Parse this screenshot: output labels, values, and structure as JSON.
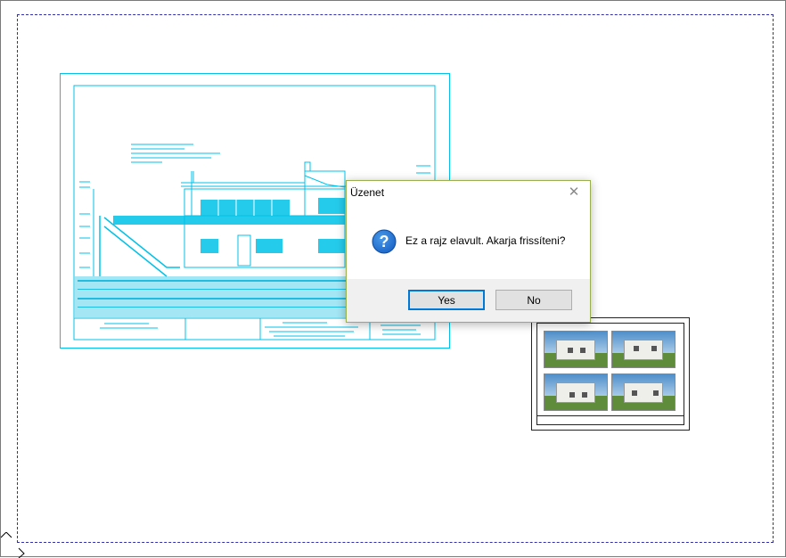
{
  "dialog": {
    "title": "Üzenet",
    "message": "Ez a rajz elavult. Akarja frissíteni?",
    "yes_label": "Yes",
    "no_label": "No",
    "close_glyph": "✕",
    "icon": "question-icon"
  },
  "colors": {
    "drawing_line": "#00c2e8",
    "sheet_border": "#2f2fb0",
    "dialog_border": "#9ab04c",
    "default_button_border": "#0078d7",
    "question_icon": "#1a64c8"
  }
}
